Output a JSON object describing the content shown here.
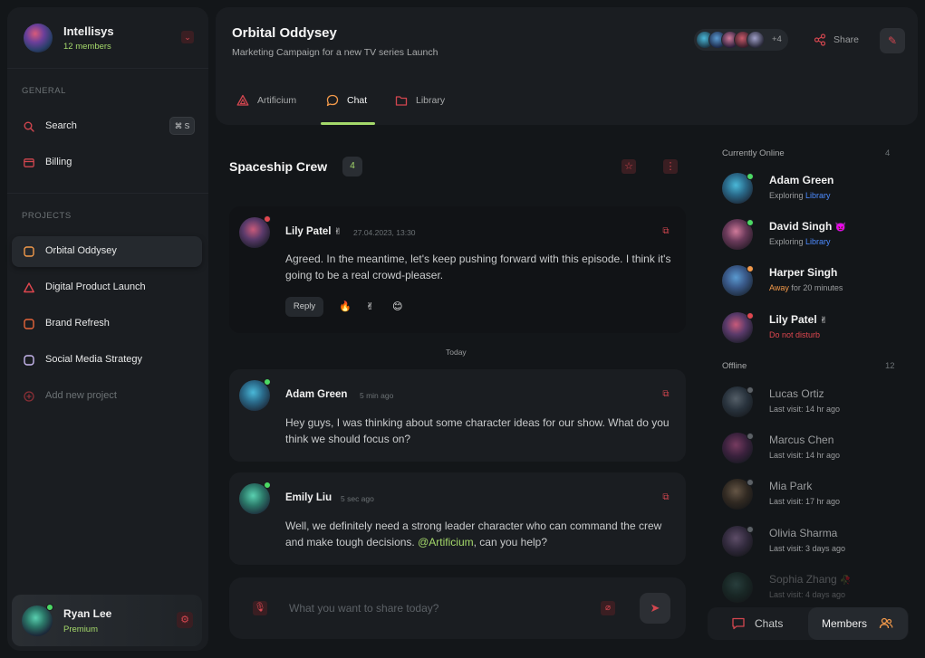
{
  "workspace": {
    "name": "Intellisys",
    "members": "12 members"
  },
  "sidebar": {
    "general_label": "GENERAL",
    "search_label": "Search",
    "search_shortcut": "⌘ S",
    "billing_label": "Billing",
    "projects_label": "PROJECTS",
    "projects": [
      {
        "label": "Orbital Oddysey",
        "color": "#f2994a"
      },
      {
        "label": "Digital Product Launch",
        "color": "#e0474f"
      },
      {
        "label": "Brand Refresh",
        "color": "#e8653a"
      },
      {
        "label": "Social Media Strategy",
        "color": "#c9b8f0"
      }
    ],
    "add_project_label": "Add new project"
  },
  "current_user": {
    "name": "Ryan Lee",
    "plan": "Premium"
  },
  "header": {
    "title": "Orbital Oddysey",
    "subtitle": "Marketing Campaign for a new TV series Launch",
    "avatar_more": "+4",
    "share_label": "Share",
    "tabs": [
      {
        "label": "Artificium"
      },
      {
        "label": "Chat"
      },
      {
        "label": "Library"
      }
    ]
  },
  "chat": {
    "title": "Spaceship Crew",
    "count": "4",
    "today_label": "Today",
    "messages": [
      {
        "name": "Lily Patel",
        "time": "27.04.2023, 13:30",
        "text": "Agreed. In the meantime, let's keep pushing forward with this episode. I think it's going to be a real crowd-pleaser.",
        "reply_label": "Reply",
        "reactions": [
          "🔥",
          "✌",
          "😊"
        ]
      },
      {
        "name": "Adam Green",
        "time": "5 min ago",
        "text": "Hey guys, I was thinking about some character ideas for our show. What do you think we should focus on?"
      },
      {
        "name": "Emily Liu",
        "time": "5 sec ago",
        "text_before": "Well, we definitely need a strong leader character who can command the crew and make tough decisions.",
        "mention": "@Artificium",
        "text_after": ", can you help?"
      }
    ],
    "composer_placeholder": "What you want to share today?"
  },
  "members_panel": {
    "online_label": "Currently Online",
    "online_count": "4",
    "offline_label": "Offline",
    "offline_count": "12",
    "online": [
      {
        "name": "Adam Green",
        "status_prefix": "Exploring ",
        "status_highlight": "Library"
      },
      {
        "name": "David Singh",
        "status_prefix": "Exploring ",
        "status_highlight": "Library"
      },
      {
        "name": "Harper Singh",
        "status_prefix": "",
        "status_highlight": "Away",
        "status_suffix": " for 20 minutes"
      },
      {
        "name": "Lily Patel",
        "status_prefix": "",
        "status_highlight": "Do not disturb"
      }
    ],
    "offline": [
      {
        "name": "Lucas Ortiz",
        "status": "Last visit: 14 hr ago"
      },
      {
        "name": "Marcus Chen",
        "status": "Last visit: 14 hr ago"
      },
      {
        "name": "Mia Park",
        "status": "Last visit: 17 hr ago"
      },
      {
        "name": "Olivia Sharma",
        "status": "Last visit: 3 days ago"
      },
      {
        "name": "Sophia Zhang",
        "status": "Last visit: 4 days ago"
      }
    ],
    "tabs": {
      "chats": "Chats",
      "members": "Members"
    }
  },
  "colors": {
    "accent_green": "#a5d96b",
    "accent_red": "#d2464f",
    "link_blue": "#4d8bff",
    "away_orange": "#f2994a"
  }
}
